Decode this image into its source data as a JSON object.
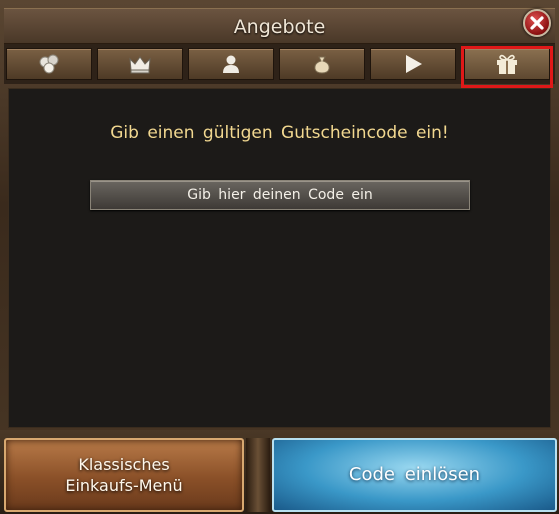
{
  "window": {
    "title": "Angebote"
  },
  "tabs": [
    {
      "icon": "coins-icon",
      "active": false
    },
    {
      "icon": "crown-icon",
      "active": false
    },
    {
      "icon": "person-icon",
      "active": false
    },
    {
      "icon": "money-bag-icon",
      "active": false
    },
    {
      "icon": "play-icon",
      "active": false
    },
    {
      "icon": "gift-icon",
      "active": true
    }
  ],
  "main": {
    "prompt": "Gib einen gültigen Gutscheincode ein!",
    "code_input": {
      "placeholder": "Gib hier deinen Code ein",
      "value": ""
    }
  },
  "footer": {
    "classic_line1": "Klassisches",
    "classic_line2": "Einkaufs-Menü",
    "redeem_label": "Code einlösen"
  },
  "colors": {
    "highlight": "#e01818",
    "prompt_text": "#f2d890",
    "redeem_button": "#3a98c8",
    "classic_button": "#8a5028"
  }
}
